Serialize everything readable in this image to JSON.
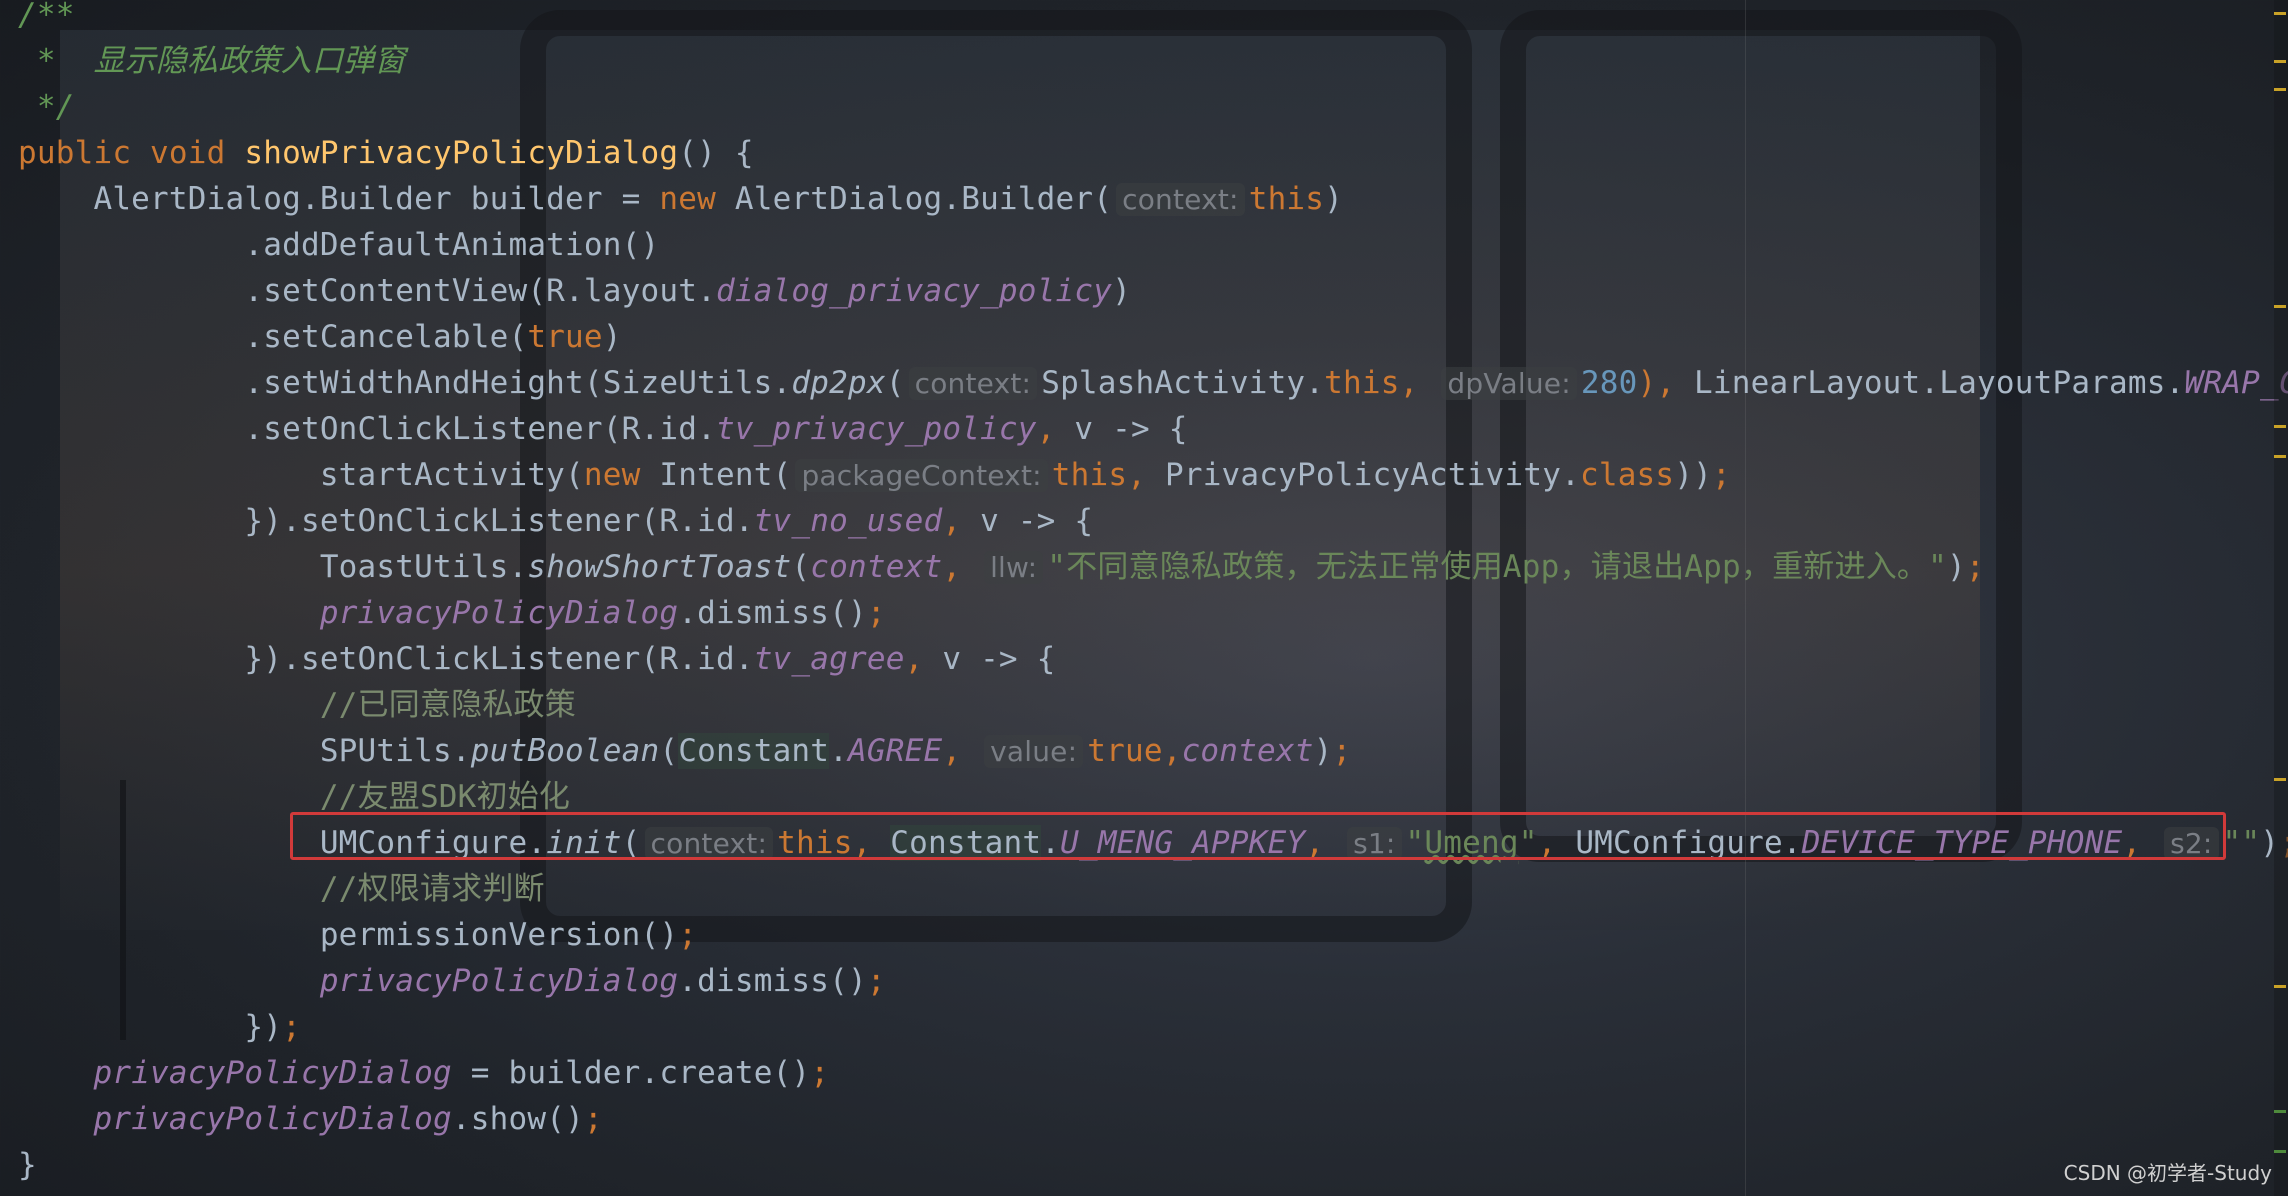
{
  "editor": {
    "lines": [
      {
        "segments": [
          {
            "c": "cmdoc",
            "t": "/**"
          }
        ]
      },
      {
        "segments": [
          {
            "c": "cmdoc",
            "t": " *  显示隐私政策入口弹窗"
          }
        ]
      },
      {
        "segments": [
          {
            "c": "cmdoc",
            "t": " */"
          }
        ]
      },
      {
        "segments": [
          {
            "c": "kw",
            "t": "public "
          },
          {
            "c": "kw",
            "t": "void "
          },
          {
            "c": "fn",
            "t": "showPrivacyPolicyDialog"
          },
          {
            "c": "",
            "t": "() {"
          }
        ]
      },
      {
        "segments": [
          {
            "c": "",
            "t": "    AlertDialog.Builder builder = "
          },
          {
            "c": "kw",
            "t": "new "
          },
          {
            "c": "",
            "t": "AlertDialog.Builder("
          },
          {
            "c": "hint",
            "t": "context:"
          },
          {
            "c": "kw",
            "t": "this"
          },
          {
            "c": "",
            "t": ")"
          }
        ]
      },
      {
        "segments": [
          {
            "c": "",
            "t": "            .addDefaultAnimation()"
          }
        ]
      },
      {
        "segments": [
          {
            "c": "",
            "t": "            .setContentView(R.layout."
          },
          {
            "c": "it",
            "t": "dialog_privacy_policy"
          },
          {
            "c": "",
            "t": ")"
          }
        ]
      },
      {
        "segments": [
          {
            "c": "",
            "t": "            .setCancelable("
          },
          {
            "c": "kw",
            "t": "true"
          },
          {
            "c": "",
            "t": ")"
          }
        ]
      },
      {
        "segments": [
          {
            "c": "",
            "t": "            .setWidthAndHeight(SizeUtils."
          },
          {
            "c": "mth",
            "t": "dp2px"
          },
          {
            "c": "",
            "t": "("
          },
          {
            "c": "hint",
            "t": "context:"
          },
          {
            "c": "",
            "t": "SplashActivity."
          },
          {
            "c": "kw",
            "t": "this"
          },
          {
            "c": "kw",
            "t": ", "
          },
          {
            "c": "hint",
            "t": "dpValue:"
          },
          {
            "c": "nm",
            "t": "280"
          },
          {
            "c": "kw",
            "t": "), "
          },
          {
            "c": "",
            "t": "LinearLayout.LayoutParams."
          },
          {
            "c": "it",
            "t": "WRAP_CONTE"
          }
        ]
      },
      {
        "segments": [
          {
            "c": "",
            "t": "            .setOnClickListener(R.id."
          },
          {
            "c": "it",
            "t": "tv_privacy_policy"
          },
          {
            "c": "kw",
            "t": ", "
          },
          {
            "c": "",
            "t": "v -> {"
          }
        ]
      },
      {
        "segments": [
          {
            "c": "",
            "t": "                startActivity("
          },
          {
            "c": "kw",
            "t": "new "
          },
          {
            "c": "",
            "t": "Intent("
          },
          {
            "c": "hint",
            "t": "packageContext:"
          },
          {
            "c": "kw",
            "t": "this, "
          },
          {
            "c": "",
            "t": "PrivacyPolicyActivity."
          },
          {
            "c": "kw",
            "t": "class"
          },
          {
            "c": "",
            "t": "))"
          },
          {
            "c": "kw",
            "t": ";"
          }
        ]
      },
      {
        "segments": [
          {
            "c": "",
            "t": "            }).setOnClickListener(R.id."
          },
          {
            "c": "it",
            "t": "tv_no_used"
          },
          {
            "c": "kw",
            "t": ", "
          },
          {
            "c": "",
            "t": "v -> {"
          }
        ]
      },
      {
        "segments": [
          {
            "c": "",
            "t": "                ToastUtils."
          },
          {
            "c": "mth",
            "t": "showShortToast"
          },
          {
            "c": "",
            "t": "("
          },
          {
            "c": "it",
            "t": "context"
          },
          {
            "c": "kw",
            "t": ", "
          },
          {
            "c": "hint",
            "t": "llw:"
          },
          {
            "c": "st",
            "t": "\"不同意隐私政策，无法正常使用App，请退出App，重新进入。\""
          },
          {
            "c": "",
            "t": ")"
          },
          {
            "c": "kw",
            "t": ";"
          }
        ]
      },
      {
        "segments": [
          {
            "c": "",
            "t": "                "
          },
          {
            "c": "it",
            "t": "privacyPolicyDialog"
          },
          {
            "c": "",
            "t": ".dismiss()"
          },
          {
            "c": "kw",
            "t": ";"
          }
        ]
      },
      {
        "segments": [
          {
            "c": "",
            "t": "            }).setOnClickListener(R.id."
          },
          {
            "c": "it",
            "t": "tv_agree"
          },
          {
            "c": "kw",
            "t": ", "
          },
          {
            "c": "",
            "t": "v -> {"
          }
        ]
      },
      {
        "segments": [
          {
            "c": "cm",
            "t": "                //已同意隐私政策"
          }
        ]
      },
      {
        "segments": [
          {
            "c": "",
            "t": "                SPUtils."
          },
          {
            "c": "mth",
            "t": "putBoolean"
          },
          {
            "c": "",
            "t": "("
          },
          {
            "c": "hl",
            "t": "Constant"
          },
          {
            "c": "",
            "t": "."
          },
          {
            "c": "it",
            "t": "AGREE"
          },
          {
            "c": "kw",
            "t": ", "
          },
          {
            "c": "hint",
            "t": "value:"
          },
          {
            "c": "kw",
            "t": "true,"
          },
          {
            "c": "it",
            "t": "context"
          },
          {
            "c": "",
            "t": ")"
          },
          {
            "c": "kw",
            "t": ";"
          }
        ]
      },
      {
        "segments": [
          {
            "c": "cm",
            "t": "                //友盟SDK初始化"
          }
        ]
      },
      {
        "segments": [
          {
            "c": "",
            "t": "                UMConfigure."
          },
          {
            "c": "mth",
            "t": "init"
          },
          {
            "c": "",
            "t": "("
          },
          {
            "c": "hint",
            "t": "context:"
          },
          {
            "c": "kw",
            "t": "this, "
          },
          {
            "c": "hl",
            "t": "Constant"
          },
          {
            "c": "",
            "t": "."
          },
          {
            "c": "it",
            "t": "U_MENG_APPKEY"
          },
          {
            "c": "kw",
            "t": ", "
          },
          {
            "c": "hint",
            "t": "s1:"
          },
          {
            "c": "st",
            "t": "\""
          },
          {
            "c": "st squig",
            "t": "Umeng"
          },
          {
            "c": "st",
            "t": "\""
          },
          {
            "c": "kw",
            "t": ", "
          },
          {
            "c": "",
            "t": "UMConfigure."
          },
          {
            "c": "it",
            "t": "DEVICE_TYPE_PHONE"
          },
          {
            "c": "kw",
            "t": ", "
          },
          {
            "c": "hint",
            "t": "s2:"
          },
          {
            "c": "st",
            "t": "\"\""
          },
          {
            "c": "",
            "t": ")"
          },
          {
            "c": "kw",
            "t": ";"
          }
        ]
      },
      {
        "segments": [
          {
            "c": "cm",
            "t": "                //权限请求判断"
          }
        ]
      },
      {
        "segments": [
          {
            "c": "",
            "t": "                permissionVersion()"
          },
          {
            "c": "kw",
            "t": ";"
          }
        ]
      },
      {
        "segments": [
          {
            "c": "",
            "t": "                "
          },
          {
            "c": "it",
            "t": "privacyPolicyDialog"
          },
          {
            "c": "",
            "t": ".dismiss()"
          },
          {
            "c": "kw",
            "t": ";"
          }
        ]
      },
      {
        "segments": [
          {
            "c": "",
            "t": "            })"
          },
          {
            "c": "kw",
            "t": ";"
          }
        ]
      },
      {
        "segments": [
          {
            "c": "",
            "t": "    "
          },
          {
            "c": "it",
            "t": "privacyPolicyDialog"
          },
          {
            "c": "",
            "t": " = builder.create()"
          },
          {
            "c": "kw",
            "t": ";"
          }
        ]
      },
      {
        "segments": [
          {
            "c": "",
            "t": "    "
          },
          {
            "c": "it",
            "t": "privacyPolicyDialog"
          },
          {
            "c": "",
            "t": ".show()"
          },
          {
            "c": "kw",
            "t": ";"
          }
        ]
      },
      {
        "segments": [
          {
            "c": "",
            "t": "}"
          }
        ]
      }
    ]
  },
  "watermark": "CSDN @初学者-Study",
  "colors": {
    "highlight_border": "#d13a3a",
    "keyword": "#cc7832",
    "function": "#ffc66d",
    "string": "#6a8759",
    "field": "#9876aa",
    "number": "#6897bb"
  }
}
